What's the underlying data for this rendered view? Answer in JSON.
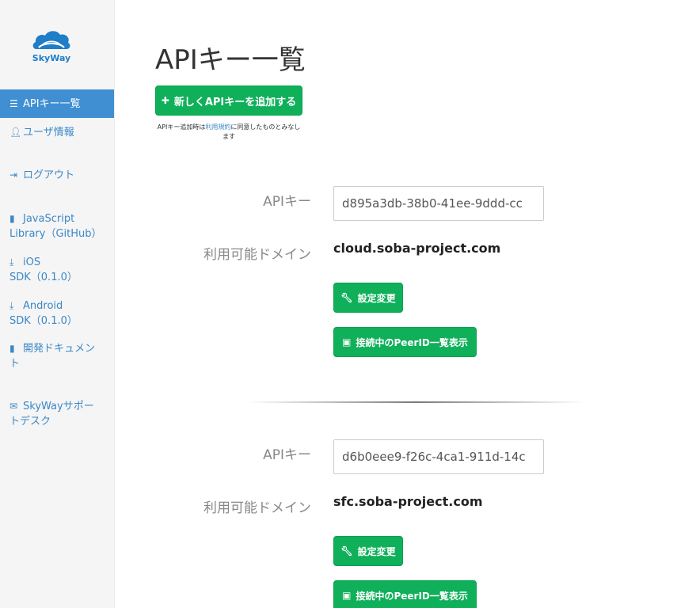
{
  "brand": {
    "logo_text": "SkyWay"
  },
  "sidebar": {
    "items": [
      {
        "icon": "list-icon",
        "line1": "APIキー一覧",
        "line2": ""
      },
      {
        "icon": "user-icon",
        "line1": "ユーザ情報",
        "line2": ""
      },
      {
        "icon": "logout-icon",
        "line1": "ログアウト",
        "line2": ""
      },
      {
        "icon": "file-icon",
        "line1": "JavaScript",
        "line2": "Library（GitHub）"
      },
      {
        "icon": "download-icon",
        "line1": "iOS",
        "line2": "SDK（0.1.0）"
      },
      {
        "icon": "download-icon",
        "line1": "Android",
        "line2": "SDK（0.1.0）"
      },
      {
        "icon": "book-icon",
        "line1": "開発ドキュメン",
        "line2": "ト"
      },
      {
        "icon": "envelope-icon",
        "line1": "SkyWayサポー",
        "line2": "トデスク"
      }
    ]
  },
  "main": {
    "title": "APIキー一覧",
    "add_button": "新しくAPIキーを追加する",
    "terms": {
      "prefix": "APIキー追加時は",
      "link": "利用規約",
      "suffix_line1": "に同意したものとみなし",
      "suffix_line2": "ます"
    },
    "api_key_label": "APIキー",
    "domain_label": "利用可能ドメイン",
    "settings_button": "設定変更",
    "peer_button": "接続中のPeerID一覧表示",
    "entries": [
      {
        "key": "d895a3db-38b0-41ee-9ddd-cc",
        "domain": "cloud.soba-project.com"
      },
      {
        "key": "d6b0eee9-f26c-4ca1-911d-14c",
        "domain": "sfc.soba-project.com"
      }
    ]
  },
  "colors": {
    "accent_blue": "#3f8fd2",
    "button_green": "#10b05a",
    "sidebar_bg": "#f5f5f5"
  }
}
